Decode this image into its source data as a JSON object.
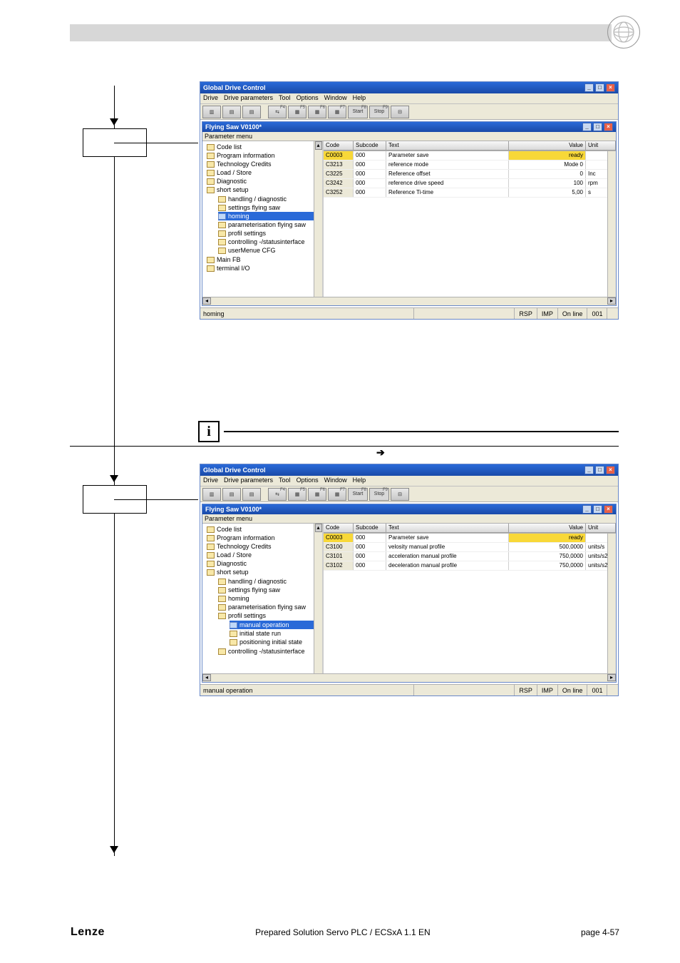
{
  "page": {
    "footer_brand": "Lenze",
    "footer_center": "Prepared Solution Servo PLC / ECSxA 1.1 EN",
    "footer_page": "page 4-57"
  },
  "win": {
    "title": "Global Drive Control",
    "menus": [
      "Drive",
      "Drive parameters",
      "Tool",
      "Options",
      "Window",
      "Help"
    ],
    "toolbar": {
      "start": "Start",
      "stop": "Stop",
      "f4": "F4",
      "f5": "F5",
      "f6": "F6",
      "f7": "F7",
      "f8": "F8",
      "f9": "F9"
    },
    "inner_title": "Flying Saw V0100*",
    "param_hdr": "Parameter menu",
    "grid_hdr": {
      "code": "Code",
      "subcode": "Subcode",
      "text": "Text",
      "value": "Value",
      "unit": "Unit"
    },
    "status": {
      "rsp": "RSP",
      "imp": "IMP",
      "online": "On line",
      "id": "001"
    }
  },
  "shot1": {
    "tree": [
      "Code list",
      "Program information",
      "Technology Credits",
      "Load / Store",
      "Diagnostic",
      "short setup"
    ],
    "tree_sub": [
      "handling / diagnostic",
      "settings flying saw",
      "homing",
      "parameterisation flying saw",
      "profil settings",
      "controlling -/statusinterface",
      "userMenue CFG"
    ],
    "tree_tail": [
      "Main FB",
      "terminal I/O"
    ],
    "sel": "homing",
    "rows": [
      {
        "code": "C0003",
        "sub": "000",
        "text": "Parameter save",
        "value": "ready",
        "unit": "",
        "sel": true
      },
      {
        "code": "C3213",
        "sub": "000",
        "text": "reference mode",
        "value": "Mode 0",
        "unit": ""
      },
      {
        "code": "C3225",
        "sub": "000",
        "text": "Reference offset",
        "value": "0",
        "unit": "Inc"
      },
      {
        "code": "C3242",
        "sub": "000",
        "text": "reference drive speed",
        "value": "100",
        "unit": "rpm"
      },
      {
        "code": "C3252",
        "sub": "000",
        "text": "Reference Ti-time",
        "value": "5,00",
        "unit": "s"
      }
    ],
    "status_left": "homing"
  },
  "shot2": {
    "tree": [
      "Code list",
      "Program information",
      "Technology Credits",
      "Load / Store",
      "Diagnostic",
      "short setup"
    ],
    "tree_sub": [
      "handling / diagnostic",
      "settings flying saw",
      "homing",
      "parameterisation flying saw",
      "profil settings"
    ],
    "tree_sub2": [
      "manual operation",
      "initial state run",
      "positioning initial state"
    ],
    "tree_tail": [
      "controlling -/statusinterface"
    ],
    "sel": "manual operation",
    "rows": [
      {
        "code": "C0003",
        "sub": "000",
        "text": "Parameter save",
        "value": "ready",
        "unit": "",
        "sel": true
      },
      {
        "code": "C3100",
        "sub": "000",
        "text": "velosity manual profile",
        "value": "500,0000",
        "unit": "units/s"
      },
      {
        "code": "C3101",
        "sub": "000",
        "text": "acceleration manual profile",
        "value": "750,0000",
        "unit": "units/s2"
      },
      {
        "code": "C3102",
        "sub": "000",
        "text": "deceleration manual profile",
        "value": "750,0000",
        "unit": "units/s2"
      }
    ],
    "status_left": "manual operation"
  },
  "info": {
    "arrow": "➔"
  }
}
